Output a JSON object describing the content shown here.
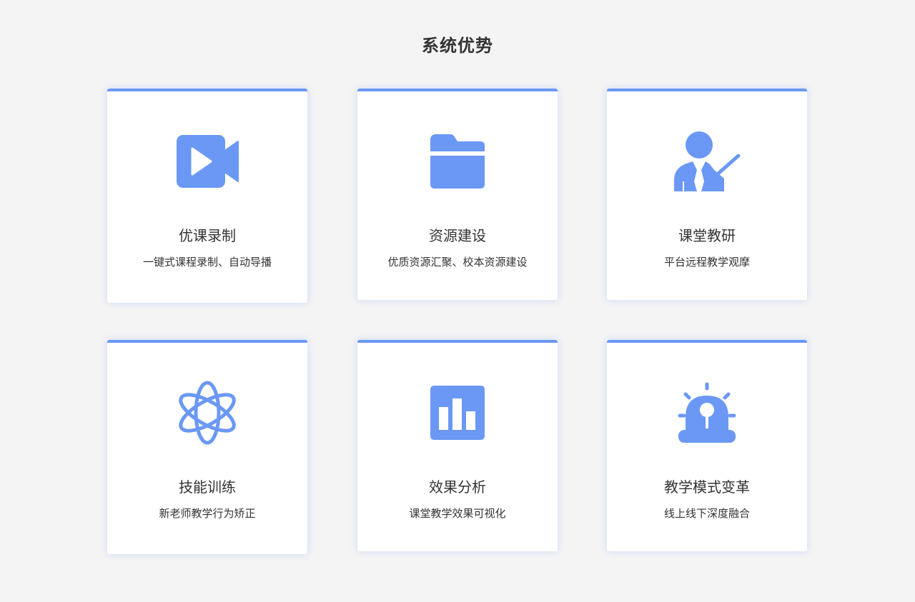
{
  "section": {
    "title": "系统优势"
  },
  "theme": {
    "accent": "#6b98f5",
    "background": "#f4f4f5",
    "card": "#ffffff",
    "text": "#333333"
  },
  "cards": [
    {
      "icon": "video-camera-icon",
      "title": "优课录制",
      "desc": "一键式课程录制、自动导播"
    },
    {
      "icon": "folder-icon",
      "title": "资源建设",
      "desc": "优质资源汇聚、校本资源建设"
    },
    {
      "icon": "teacher-icon",
      "title": "课堂教研",
      "desc": "平台远程教学观摩"
    },
    {
      "icon": "atom-icon",
      "title": "技能训练",
      "desc": "新老师教学行为矫正"
    },
    {
      "icon": "bar-chart-icon",
      "title": "效果分析",
      "desc": "课堂教学效果可视化"
    },
    {
      "icon": "alarm-light-icon",
      "title": "教学模式变革",
      "desc": "线上线下深度融合"
    }
  ]
}
